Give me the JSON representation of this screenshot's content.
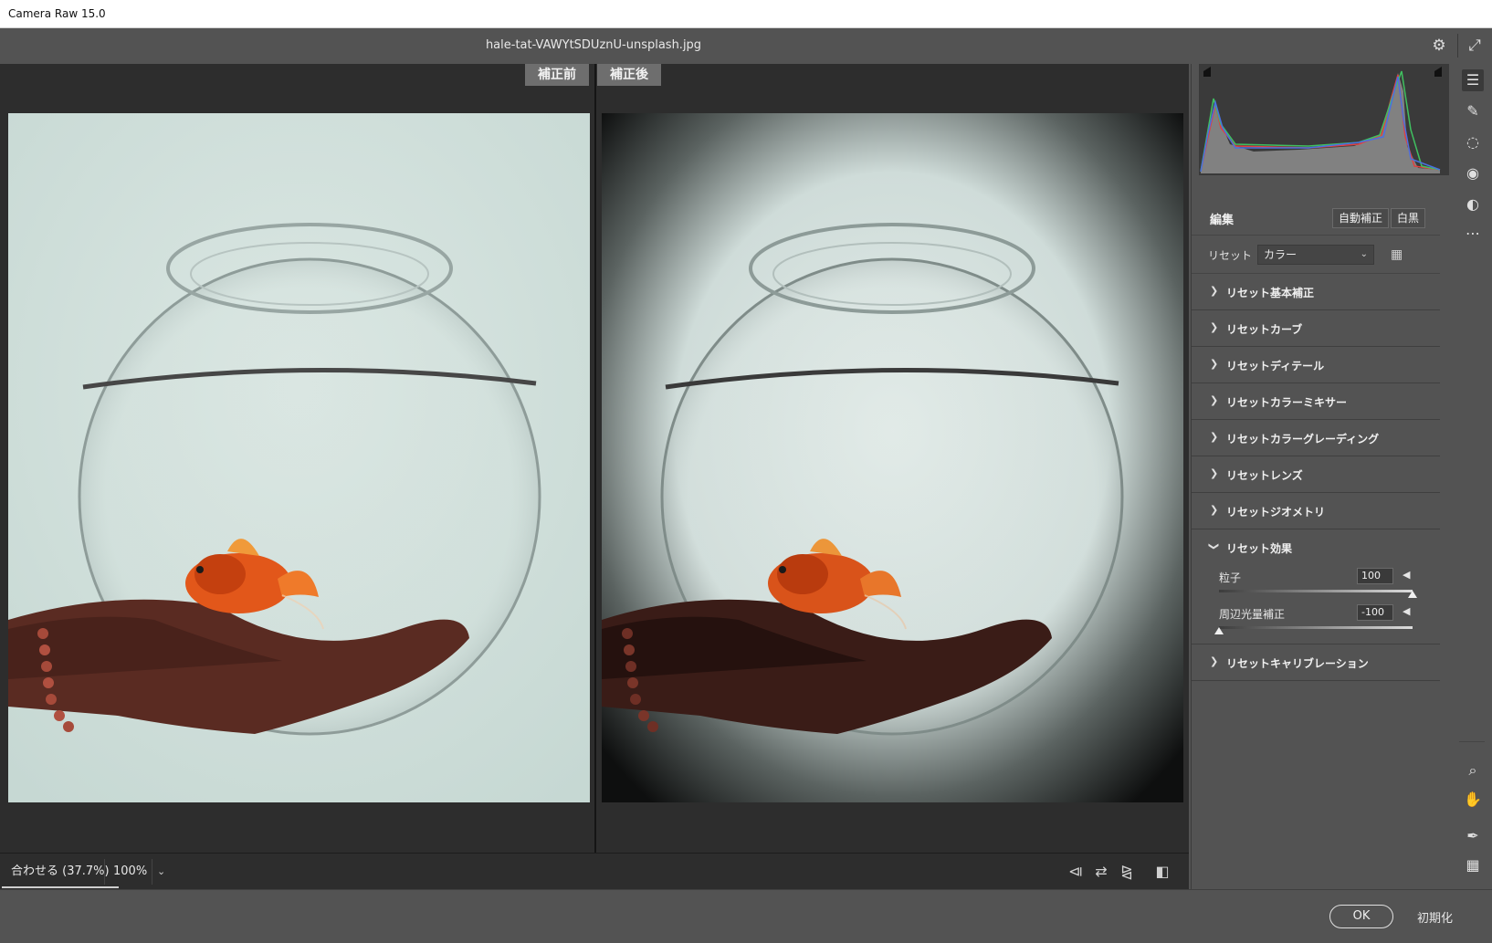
{
  "app": {
    "title": "Camera Raw 15.0"
  },
  "header": {
    "filename": "hale-tat-VAWYtSDUznU-unsplash.jpg",
    "settings_icon": "gear-icon",
    "fullscreen_icon": "expand-icon"
  },
  "viewer": {
    "before_label": "補正前",
    "after_label": "補正後"
  },
  "statusbar": {
    "zoom_fit": "合わせる (37.7%)",
    "zoom_100": "100%",
    "zoom_dropdown": "⌄"
  },
  "panel": {
    "edit_title": "編集",
    "auto_button": "自動補正",
    "bw_button": "白黒",
    "preset_label": "リセット",
    "profile_value": "カラー",
    "sections": [
      {
        "label": "リセット基本補正",
        "expanded": false
      },
      {
        "label": "リセットカーブ",
        "expanded": false
      },
      {
        "label": "リセットディテール",
        "expanded": false
      },
      {
        "label": "リセットカラーミキサー",
        "expanded": false
      },
      {
        "label": "リセットカラーグレーディング",
        "expanded": false
      },
      {
        "label": "リセットレンズ",
        "expanded": false
      },
      {
        "label": "リセットジオメトリ",
        "expanded": false
      },
      {
        "label": "リセット効果",
        "expanded": true
      },
      {
        "label": "リセットキャリブレーション",
        "expanded": false
      }
    ],
    "effects": {
      "grain": {
        "label": "粒子",
        "value": "100",
        "level": 1.0
      },
      "vignette": {
        "label": "周辺光量補正",
        "value": "-100",
        "level": 0.0
      }
    }
  },
  "footer": {
    "ok": "OK",
    "reset": "初期化"
  },
  "icons": {
    "tools": [
      "edit-sliders-icon",
      "healing-brush-icon",
      "mask-icon",
      "red-eye-icon",
      "presets-icon",
      "more-icon"
    ],
    "bottom_tools": [
      "zoom-icon",
      "hand-icon",
      "color-sampler-icon",
      "grid-overlay-icon"
    ]
  },
  "colors": {
    "panel_bg": "#535353",
    "viewer_bg": "#2d2d2d",
    "accent_fish": "#e2571a"
  }
}
